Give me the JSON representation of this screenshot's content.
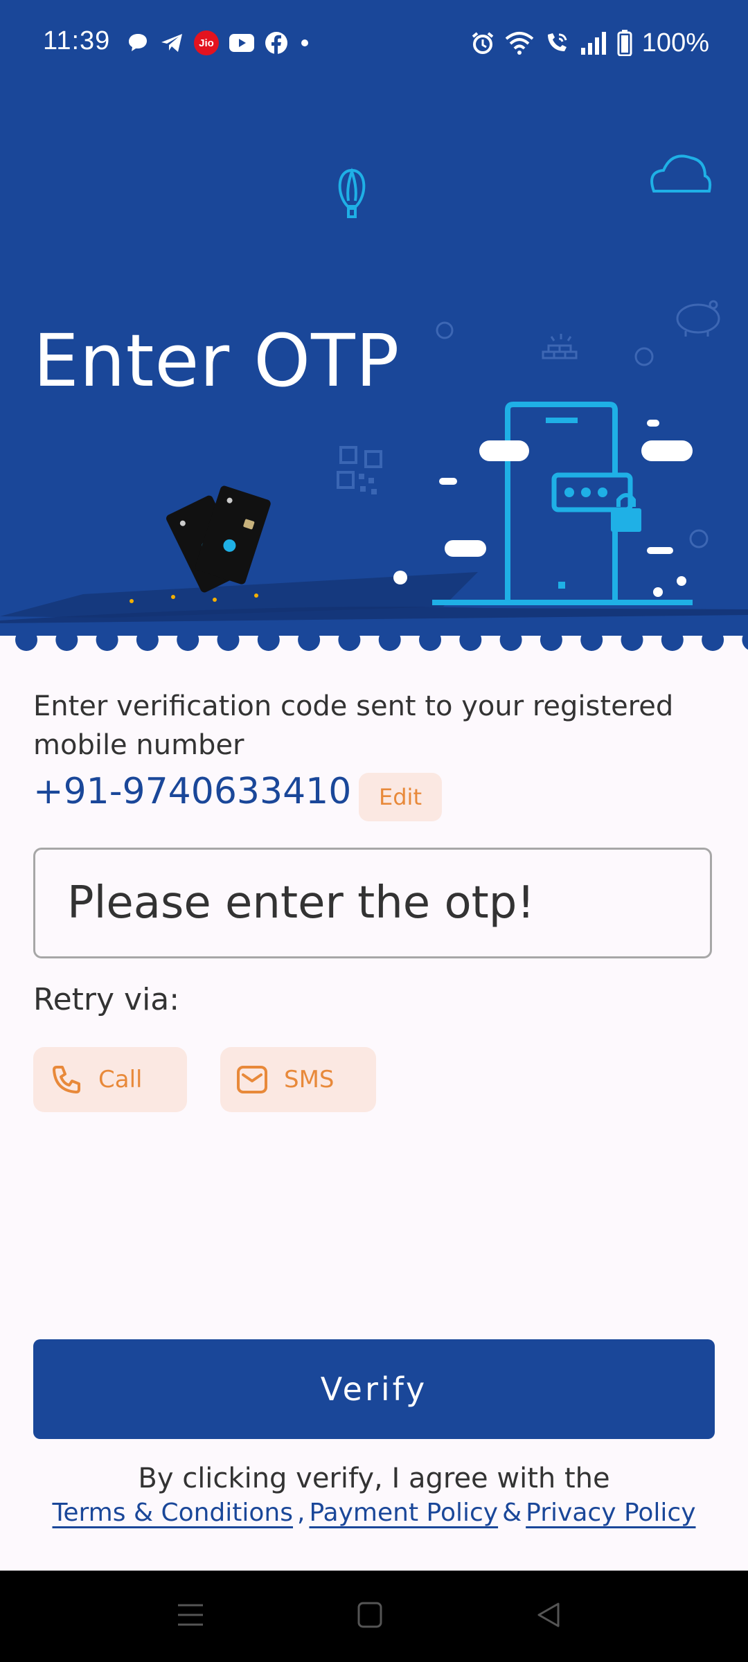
{
  "status_bar": {
    "time": "11:39",
    "carrier_badge": "Jio",
    "battery": "100%"
  },
  "hero": {
    "title": "Enter OTP"
  },
  "otp": {
    "instruction": "Enter verification code sent to your registered mobile number",
    "phone": "+91-9740633410",
    "edit_label": "Edit",
    "placeholder": "Please enter the otp!"
  },
  "retry": {
    "label": "Retry via:",
    "call_label": "Call",
    "sms_label": "SMS"
  },
  "actions": {
    "verify_label": "Verify"
  },
  "footer": {
    "agree_text": "By clicking verify, I agree with the",
    "terms_label": "Terms & Conditions",
    "comma": ",",
    "payment_label": "Payment Policy",
    "amp": "&",
    "privacy_label": "Privacy Policy"
  },
  "colors": {
    "brand": "#1A4799",
    "accent": "#E8893A",
    "accent_bg": "#FBE8E2",
    "background": "#FDF9FD"
  },
  "icons": [
    "chat-icon",
    "telegram-icon",
    "jio-icon",
    "youtube-icon",
    "facebook-icon",
    "alarm-icon",
    "wifi-icon",
    "wifi-call-icon",
    "signal-icon",
    "battery-icon",
    "phone-icon",
    "mail-icon",
    "menu-icon",
    "home-icon",
    "back-icon"
  ]
}
